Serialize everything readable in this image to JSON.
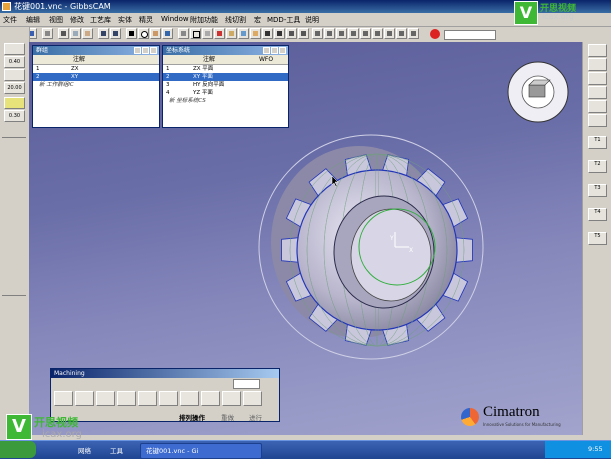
{
  "window": {
    "title": "花键001.vnc - GibbsCAM"
  },
  "menu": [
    "文件",
    "编辑",
    "视图",
    "修改",
    "工艺库",
    "实体",
    "精灵",
    "Window",
    "附加功能",
    "线切割",
    "宏",
    "MDD-工具",
    "说明"
  ],
  "left_toolbar": {
    "values": [
      "0.40",
      "20.00",
      "0.30"
    ]
  },
  "groups_panel": {
    "title": "群组",
    "col_annotation": "注解",
    "rows": [
      {
        "num": "1",
        "name": "ZX"
      },
      {
        "num": "2",
        "name": "XY",
        "selected": true
      },
      {
        "num": "",
        "name": "新 工作群组IC"
      }
    ]
  },
  "coords_panel": {
    "title": "坐标系统",
    "col_annotation": "注解",
    "col_wfo": "WFO",
    "rows": [
      {
        "num": "1",
        "name": "ZX 平面"
      },
      {
        "num": "2",
        "name": "XY 平面",
        "selected": true
      },
      {
        "num": "3",
        "name": "HY 反向平面"
      },
      {
        "num": "4",
        "name": "YZ 平面"
      },
      {
        "num": "",
        "name": "新 坐标系统CS"
      }
    ]
  },
  "right_toolbar": {
    "labels": [
      "T1",
      "T2",
      "T3",
      "T4",
      "T5"
    ]
  },
  "machining_palette": {
    "title": "Machining",
    "run_label": "排列操作",
    "redo_label": "重做",
    "do_label": "进行"
  },
  "watermark": {
    "brand": "开思视频",
    "url": "icax.org"
  },
  "cimatron": {
    "name": "Cimatron",
    "tagline": "Innovative Solutions for Manufacturing"
  },
  "taskbar": {
    "start_label": "开始",
    "items": [
      "网络",
      "工具"
    ],
    "active_window": "花键001.vnc - Gi",
    "clock": "9:55"
  },
  "colors": {
    "viewport_top": "#595c98",
    "viewport_bottom": "#a2a4cd",
    "title_bar": "#0a246a",
    "selection": "#316ac5",
    "watermark_green": "#3fb836"
  }
}
